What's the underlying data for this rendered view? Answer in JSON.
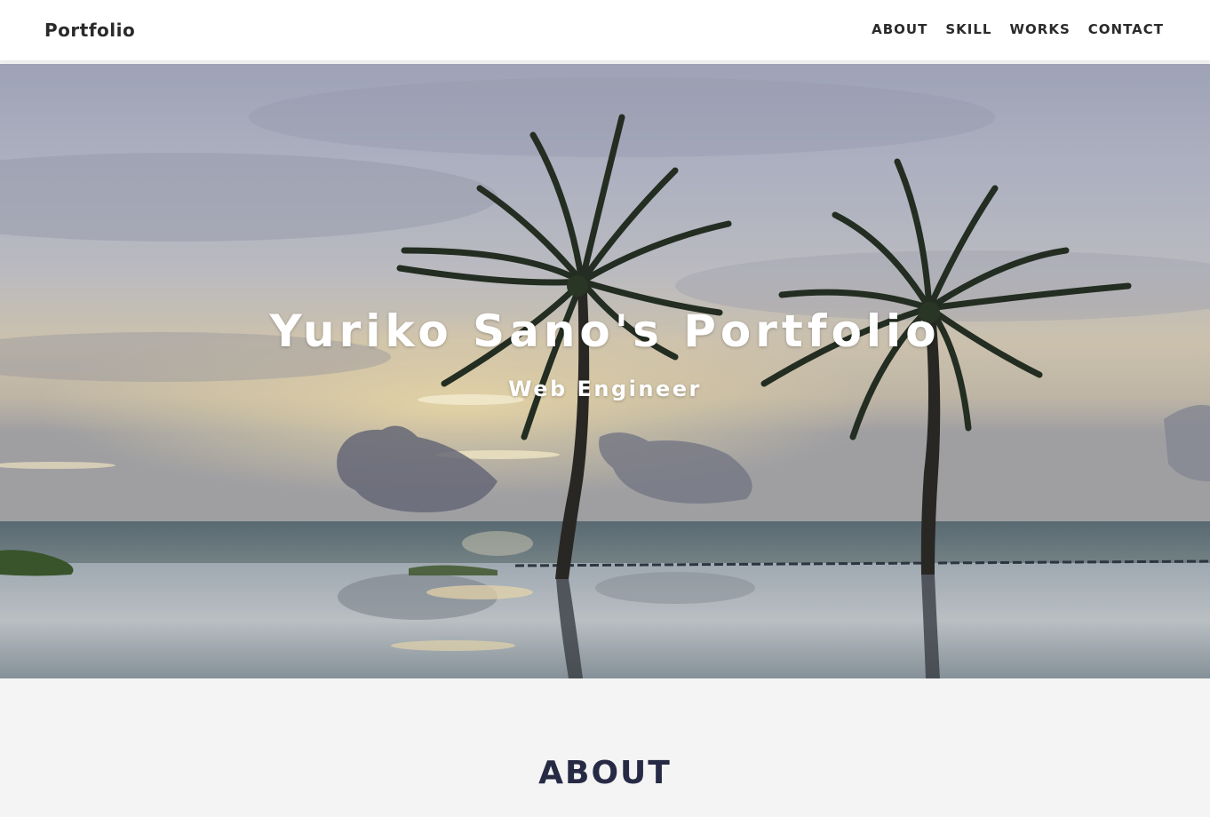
{
  "navbar": {
    "brand": "Portfolio",
    "links": [
      "ABOUT",
      "SKILL",
      "WORKS",
      "CONTACT"
    ]
  },
  "hero": {
    "title": "Yuriko Sano's Portfolio",
    "subtitle": "Web Engineer",
    "background_image": "palm-trees-infinity-pool-sunset-photo"
  },
  "about": {
    "heading": "ABOUT"
  },
  "colors": {
    "nav_bg": "#ffffff",
    "nav_text": "#2a2a2a",
    "section_bg": "#f4f4f4",
    "heading_text": "#272a45",
    "hero_text": "#ffffff"
  }
}
